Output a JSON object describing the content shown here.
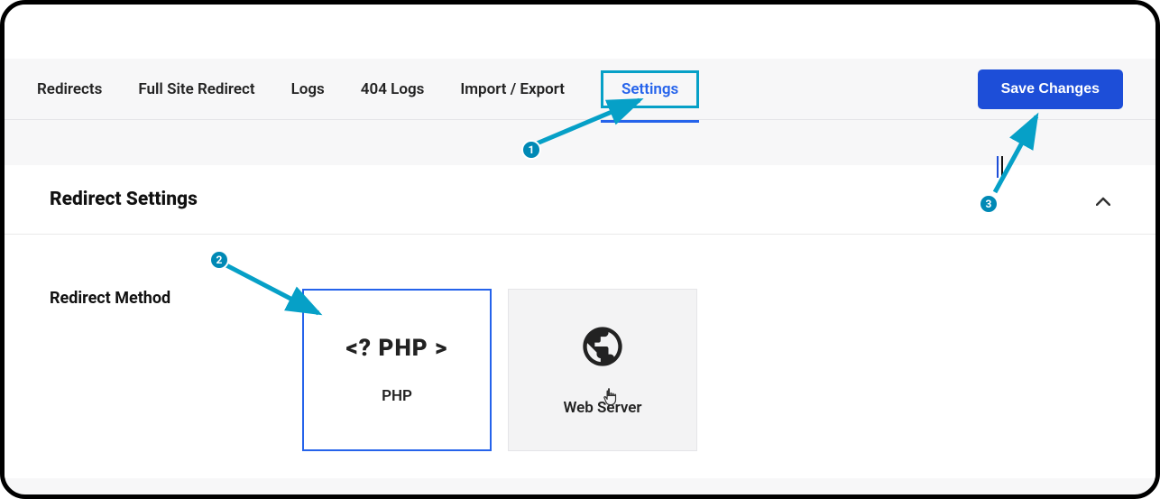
{
  "tabs": {
    "redirects": "Redirects",
    "full_site": "Full Site Redirect",
    "logs": "Logs",
    "logs_404": "404 Logs",
    "import_export": "Import / Export",
    "settings": "Settings"
  },
  "buttons": {
    "save": "Save Changes"
  },
  "panel": {
    "title": "Redirect Settings",
    "field_label": "Redirect Method"
  },
  "options": {
    "php": {
      "label": "PHP",
      "icon_text": "<? PHP >"
    },
    "web_server": {
      "label": "Web Server"
    }
  },
  "annotations": {
    "n1": "1",
    "n2": "2",
    "n3": "3"
  }
}
